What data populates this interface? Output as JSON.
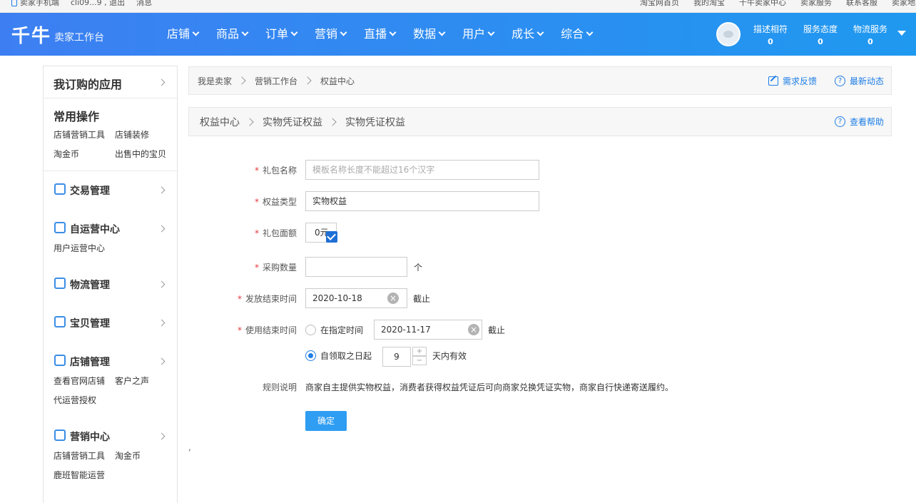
{
  "topbar": {
    "left": [
      "卖家手机端",
      "cli09...9 , 退出",
      "消息"
    ],
    "right": [
      "淘宝网首页",
      "我的淘宝",
      "千牛卖家中心",
      "卖家服务",
      "联系客服",
      "卖家地图"
    ]
  },
  "header": {
    "logo": "千牛",
    "subtitle": "卖家工作台",
    "nav": [
      "店铺",
      "商品",
      "订单",
      "营销",
      "直播",
      "数据",
      "用户",
      "成长",
      "综合"
    ],
    "scores": [
      {
        "label": "描述相符",
        "value": "0"
      },
      {
        "label": "服务态度",
        "value": "0"
      },
      {
        "label": "物流服务",
        "value": "0"
      }
    ]
  },
  "sidebar": {
    "apps_title": "我订购的应用",
    "common_title": "常用操作",
    "common_links": [
      "店铺营销工具",
      "店铺装修",
      "淘金币",
      "出售中的宝贝"
    ],
    "groups": [
      {
        "label": "交易管理",
        "links": []
      },
      {
        "label": "自运营中心",
        "links": [
          "用户运营中心"
        ]
      },
      {
        "label": "物流管理",
        "links": []
      },
      {
        "label": "宝贝管理",
        "links": []
      },
      {
        "label": "店铺管理",
        "links": [
          "查看官网店铺",
          "客户之声",
          "代运营授权"
        ]
      },
      {
        "label": "营销中心",
        "links": [
          "店铺营销工具",
          "淘金币",
          "鹿班智能运营"
        ]
      }
    ]
  },
  "breadcrumb1": {
    "items": [
      "我是卖家",
      "营销工作台",
      "权益中心"
    ],
    "feedback": "需求反馈",
    "news": "最新动态"
  },
  "breadcrumb2": {
    "items": [
      "权益中心",
      "实物凭证权益",
      "实物凭证权益"
    ],
    "help": "查看帮助"
  },
  "form": {
    "gift_name_label": "礼包名称",
    "gift_name_placeholder": "模板名称长度不能超过16个汉字",
    "type_label": "权益类型",
    "type_value": "实物权益",
    "face_label": "礼包面额",
    "face_value": "0元",
    "qty_label": "采购数量",
    "qty_value": "",
    "qty_unit": "个",
    "issue_end_label": "发放结束时间",
    "issue_end_value": "2020-10-18",
    "until": "截止",
    "use_end_label": "使用结束时间",
    "opt_fixed": "在指定时间",
    "use_end_value": "2020-11-17",
    "opt_relative": "自领取之日起",
    "days_value": "9",
    "days_suffix": "天内有效",
    "rules_label": "规则说明",
    "rules_text": "商家自主提供实物权益，消费者获得权益凭证后可向商家兑换凭证实物，商家自行快递寄送履约。",
    "submit": "确定",
    "stray": ","
  },
  "colors": {
    "accent": "#1e7ee6",
    "header_start": "#3d7ff2",
    "header_end": "#1f99f0",
    "required": "#e4393c"
  }
}
